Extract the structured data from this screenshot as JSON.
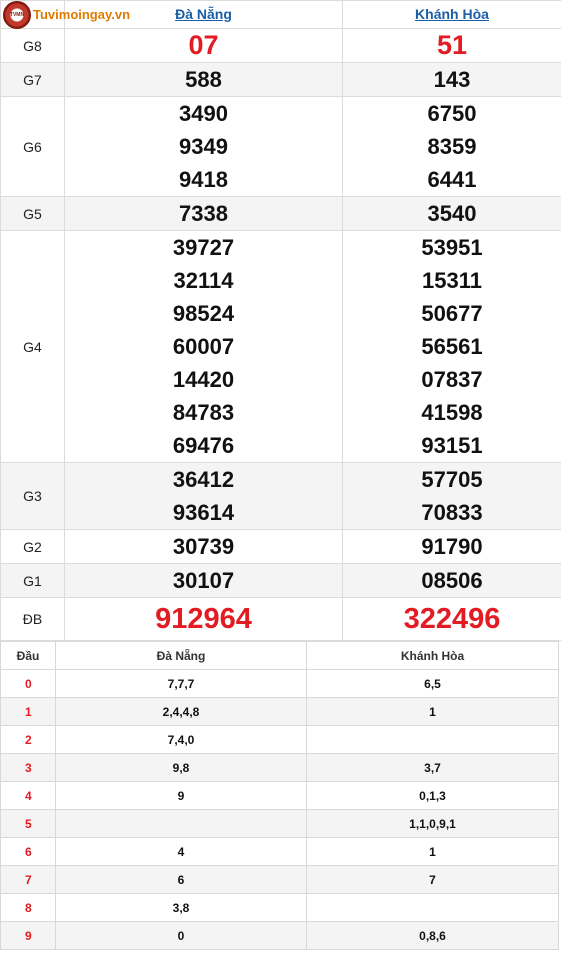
{
  "header": {
    "logo_text": "Tuvimoingay.vn",
    "logo_badge": "TVMN",
    "col1": "Đà Nẵng",
    "col2": "Khánh Hòa"
  },
  "prizes": [
    {
      "label": "G8",
      "a": [
        "07"
      ],
      "b": [
        "51"
      ]
    },
    {
      "label": "G7",
      "a": [
        "588"
      ],
      "b": [
        "143"
      ]
    },
    {
      "label": "G6",
      "a": [
        "3490",
        "9349",
        "9418"
      ],
      "b": [
        "6750",
        "8359",
        "6441"
      ]
    },
    {
      "label": "G5",
      "a": [
        "7338"
      ],
      "b": [
        "3540"
      ]
    },
    {
      "label": "G4",
      "a": [
        "39727",
        "32114",
        "98524",
        "60007",
        "14420",
        "84783",
        "69476"
      ],
      "b": [
        "53951",
        "15311",
        "50677",
        "56561",
        "07837",
        "41598",
        "93151"
      ]
    },
    {
      "label": "G3",
      "a": [
        "36412",
        "93614"
      ],
      "b": [
        "57705",
        "70833"
      ]
    },
    {
      "label": "G2",
      "a": [
        "30739"
      ],
      "b": [
        "91790"
      ]
    },
    {
      "label": "G1",
      "a": [
        "30107"
      ],
      "b": [
        "08506"
      ]
    },
    {
      "label": "ĐB",
      "a": [
        "912964"
      ],
      "b": [
        "322496"
      ]
    }
  ],
  "loto": {
    "headers": [
      "Đầu",
      "Đà Nẵng",
      "Khánh Hòa"
    ],
    "rows": [
      {
        "dau": "0",
        "a": "7,7,7",
        "b": "6,5"
      },
      {
        "dau": "1",
        "a": "2,4,4,8",
        "b": "1"
      },
      {
        "dau": "2",
        "a": "7,4,0",
        "b": ""
      },
      {
        "dau": "3",
        "a": "9,8",
        "b": "3,7"
      },
      {
        "dau": "4",
        "a": "9",
        "b": "0,1,3"
      },
      {
        "dau": "5",
        "a": "",
        "b": "1,1,0,9,1"
      },
      {
        "dau": "6",
        "a": "4",
        "b": "1"
      },
      {
        "dau": "7",
        "a": "6",
        "b": "7"
      },
      {
        "dau": "8",
        "a": "3,8",
        "b": ""
      },
      {
        "dau": "9",
        "a": "0",
        "b": "0,8,6"
      }
    ]
  },
  "colors": {
    "accent_red": "#e31b23",
    "link_blue": "#1b5ea8",
    "logo_orange": "#e07b00"
  }
}
